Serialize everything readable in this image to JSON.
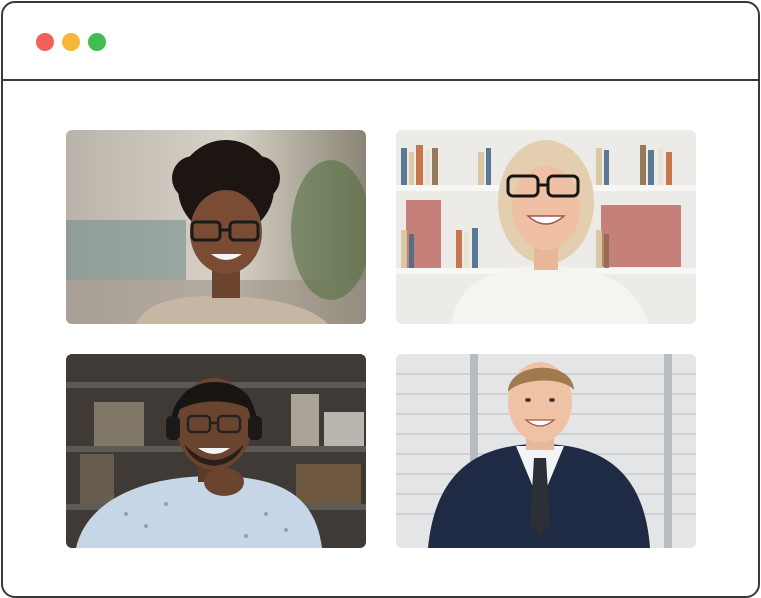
{
  "window": {
    "controls": [
      {
        "name": "close",
        "color": "#f25f5c"
      },
      {
        "name": "minimize",
        "color": "#f6b73c"
      },
      {
        "name": "maximize",
        "color": "#3fbf52"
      }
    ]
  },
  "participants": [
    {
      "icon": "participant-video-woman-curly-hair"
    },
    {
      "icon": "participant-video-woman-blonde-glasses"
    },
    {
      "icon": "participant-video-man-headset"
    },
    {
      "icon": "participant-video-man-suit"
    }
  ]
}
